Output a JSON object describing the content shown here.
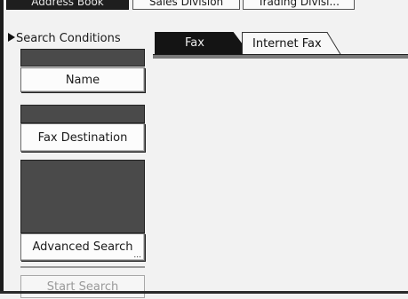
{
  "top_tabs": [
    {
      "label": "Address Book",
      "active": true
    },
    {
      "label": "Sales Division",
      "active": false
    },
    {
      "label": "Trading Divisi...",
      "active": false
    }
  ],
  "search_conditions": {
    "heading": "Search Conditions",
    "name_label": "Name",
    "fax_destination_label": "Fax Destination",
    "advanced_search_label": "Advanced Search",
    "advanced_search_more": "...",
    "start_search_label": "Start Search",
    "start_search_enabled": false
  },
  "destination_tabs": [
    {
      "label": "Fax",
      "active": true
    },
    {
      "label": "Internet Fax",
      "active": false
    }
  ],
  "colors": {
    "active_tab": "#141414",
    "field_fill": "#4a4a4a",
    "background": "#f2f2f2",
    "disabled_text": "#9a9a9a"
  }
}
